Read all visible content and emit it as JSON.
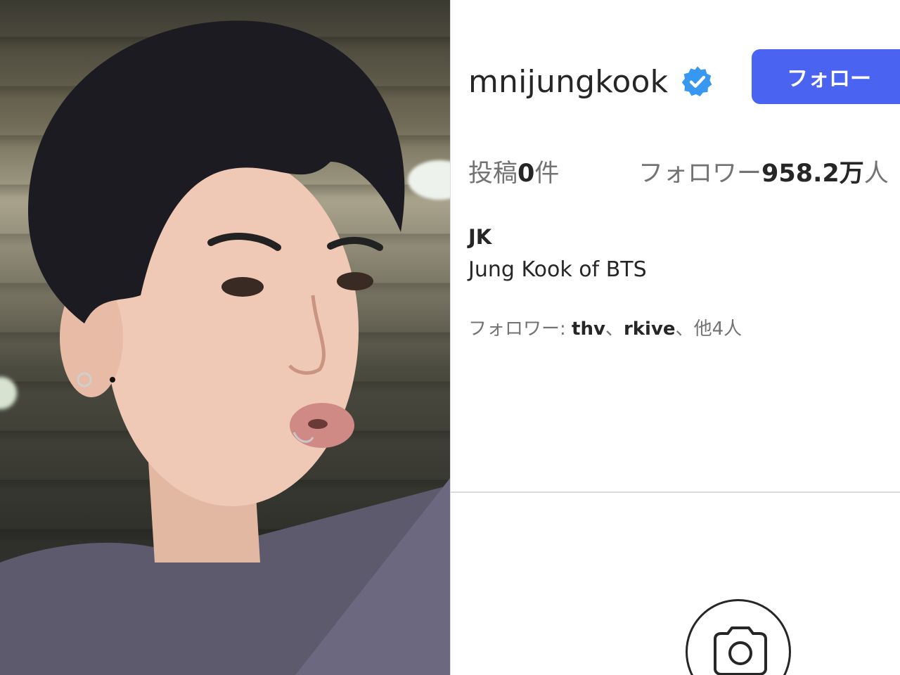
{
  "profile": {
    "username": "mnijungkook",
    "verified_icon": "verified-badge-icon",
    "follow_button_label": "フォロー",
    "stats": {
      "posts_label": "投稿",
      "posts_count": "0",
      "posts_unit": "件",
      "followers_label": "フォロワー",
      "followers_count": "958.2万",
      "followers_unit": "人"
    },
    "display_name": "JK",
    "bio": "Jung Kook of BTS",
    "followed_by": {
      "prefix": "フォロワー: ",
      "user1": "thv",
      "sep1": "、",
      "user2": "rkive",
      "sep2": "、",
      "others": "他4人"
    },
    "empty_posts_icon": "camera-icon"
  },
  "colors": {
    "follow_button": "#4a63f0",
    "verified": "#3897f0",
    "text_primary": "#262626",
    "text_secondary": "#737373"
  }
}
